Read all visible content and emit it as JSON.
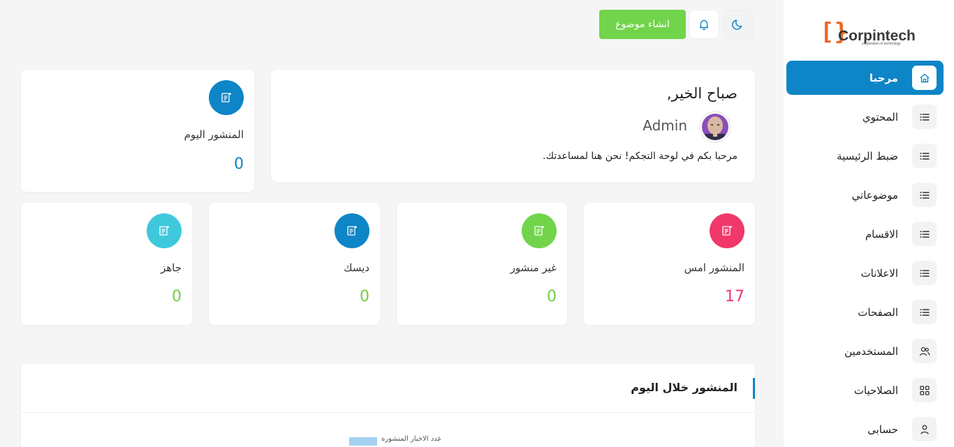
{
  "brand": {
    "name": "Corpintech",
    "tagline": "corporation in technology"
  },
  "sidebar": {
    "items": [
      {
        "label": "مرحبا",
        "icon": "home-icon",
        "active": true
      },
      {
        "label": "المحتوي",
        "icon": "list-icon"
      },
      {
        "label": "ضبط الرئيسية",
        "icon": "list-icon"
      },
      {
        "label": "موضوعاتي",
        "icon": "list-icon"
      },
      {
        "label": "الاقسام",
        "icon": "list-icon"
      },
      {
        "label": "الاعلانات",
        "icon": "list-icon"
      },
      {
        "label": "الصفحات",
        "icon": "list-icon"
      },
      {
        "label": "المستخدمين",
        "icon": "users-icon"
      },
      {
        "label": "الصلاحيات",
        "icon": "grid-icon"
      },
      {
        "label": "حسابى",
        "icon": "user-icon"
      }
    ]
  },
  "topbar": {
    "create_label": "انشاء موضوع"
  },
  "welcome": {
    "greeting": "صباح الخير,",
    "user": "Admin",
    "message": "مرحبا بكم في لوحة التجكم! نحن هنا لمساعدتك."
  },
  "stats": {
    "today": {
      "label": "المنشور اليوم",
      "value": "0",
      "color": "#0d85c6"
    },
    "yesterday": {
      "label": "المنشور امس",
      "value": "17",
      "color": "#f0386b"
    },
    "unpublished": {
      "label": "غير منشور",
      "value": "0",
      "color": "#72d44b"
    },
    "desk": {
      "label": "ديسك",
      "value": "0",
      "color": "#0d85c6"
    },
    "ready": {
      "label": "جاهز",
      "value": "0",
      "color": "#3fc8dc"
    }
  },
  "chart": {
    "title": "المنشور خلال اليوم",
    "legend": "عدد الاخبار المنشوره"
  },
  "colors": {
    "accent": "#0d85c6",
    "green": "#72d44b",
    "pink": "#f0386b",
    "cyan": "#3fc8dc",
    "value_green": "#6fcf3f"
  }
}
